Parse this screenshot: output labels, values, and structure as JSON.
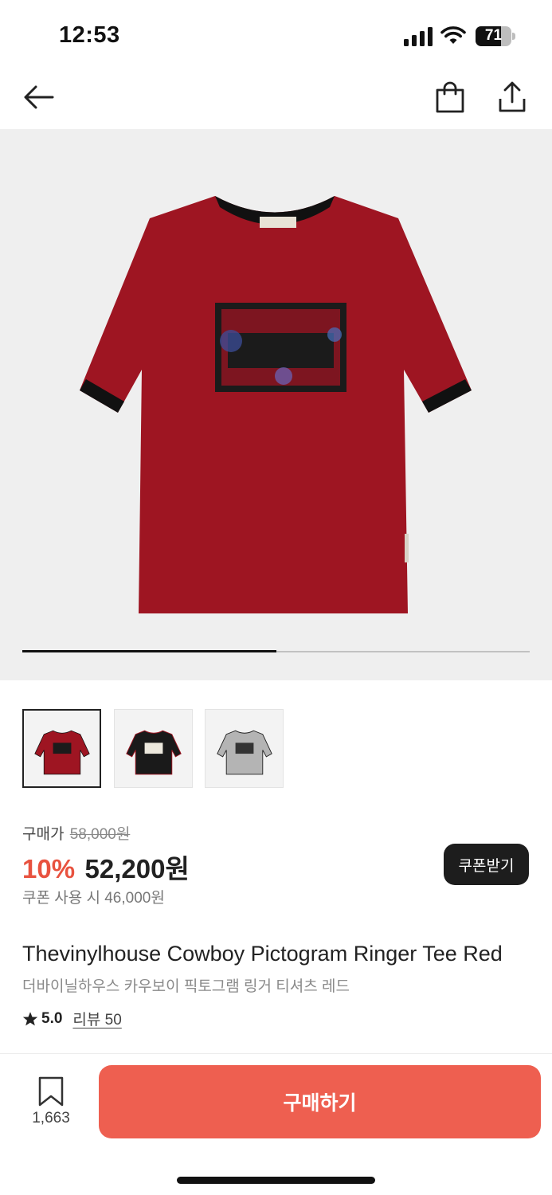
{
  "status_bar": {
    "time": "12:53",
    "battery_level": "71",
    "battery_fraction": 0.71
  },
  "top_nav": {
    "back_icon": "arrow-left-icon",
    "cart_icon": "shopping-bag-icon",
    "share_icon": "share-icon"
  },
  "gallery": {
    "progress_fraction": 0.5,
    "product_color": "#9e1522",
    "trim_color": "#111111",
    "thumbnails": [
      {
        "color": "#9e1522",
        "trim": "#111111",
        "selected": true
      },
      {
        "color": "#1a1a1a",
        "trim": "#9e1522",
        "selected": false
      },
      {
        "color": "#b4b4b4",
        "trim": "#222222",
        "selected": false
      }
    ]
  },
  "price": {
    "label": "구매가",
    "original": "58,000원",
    "discount": "10%",
    "final": "52,200원",
    "coupon_text": "쿠폰 사용 시 46,000원",
    "coupon_button": "쿠폰받기",
    "accent": "#e8523f"
  },
  "product": {
    "title_en": "Thevinylhouse Cowboy Pictogram Ringer Tee Red",
    "title_ko": "더바이닐하우스 카우보이 픽토그램 링거 티셔츠 레드",
    "rating": "5.0",
    "review_link": "리뷰 50"
  },
  "bottom_bar": {
    "wish_icon": "bookmark-icon",
    "wish_count": "1,663",
    "buy_label": "구매하기",
    "buy_color": "#ee5f50"
  }
}
